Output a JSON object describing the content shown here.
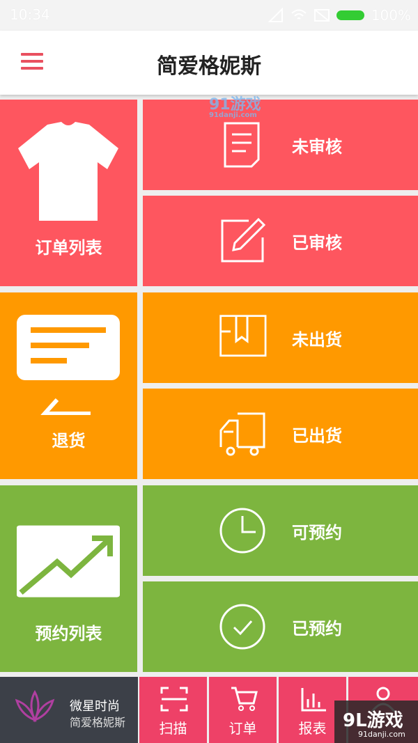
{
  "status_bar": {
    "time": "10:34",
    "battery_percent": "100%"
  },
  "app_bar": {
    "title": "简爱格妮斯"
  },
  "watermark_top": {
    "logo": "91游戏",
    "site": "91danji.com"
  },
  "colors": {
    "red": "#fe565f",
    "orange": "#ff9900",
    "green": "#7db53f",
    "nav_pink": "#ee4167",
    "brand_dark": "#3c4048"
  },
  "tiles": {
    "order_list": {
      "label": "订单列表",
      "icon": "tshirt-icon"
    },
    "unreviewed": {
      "label": "未审核",
      "icon": "document-icon"
    },
    "reviewed": {
      "label": "已审核",
      "icon": "edit-icon"
    },
    "returns": {
      "label": "退货",
      "icon": "message-icon"
    },
    "not_shipped": {
      "label": "未出货",
      "icon": "box-icon"
    },
    "shipped": {
      "label": "已出货",
      "icon": "truck-icon"
    },
    "reservation_list": {
      "label": "预约列表",
      "icon": "trend-chart-icon"
    },
    "bookable": {
      "label": "可预约",
      "icon": "clock-icon"
    },
    "booked": {
      "label": "已预约",
      "icon": "check-circle-icon"
    }
  },
  "bottom_nav": {
    "brand_name": "微星时尚",
    "brand_sub": "简爱格妮斯",
    "items": [
      {
        "label": "扫描",
        "icon": "scan-icon"
      },
      {
        "label": "订单",
        "icon": "cart-icon"
      },
      {
        "label": "报表",
        "icon": "bar-chart-icon"
      },
      {
        "label": "",
        "icon": "user-icon"
      }
    ]
  },
  "watermark_bottom": {
    "logo": "9L游戏",
    "site": "91danji.com"
  }
}
